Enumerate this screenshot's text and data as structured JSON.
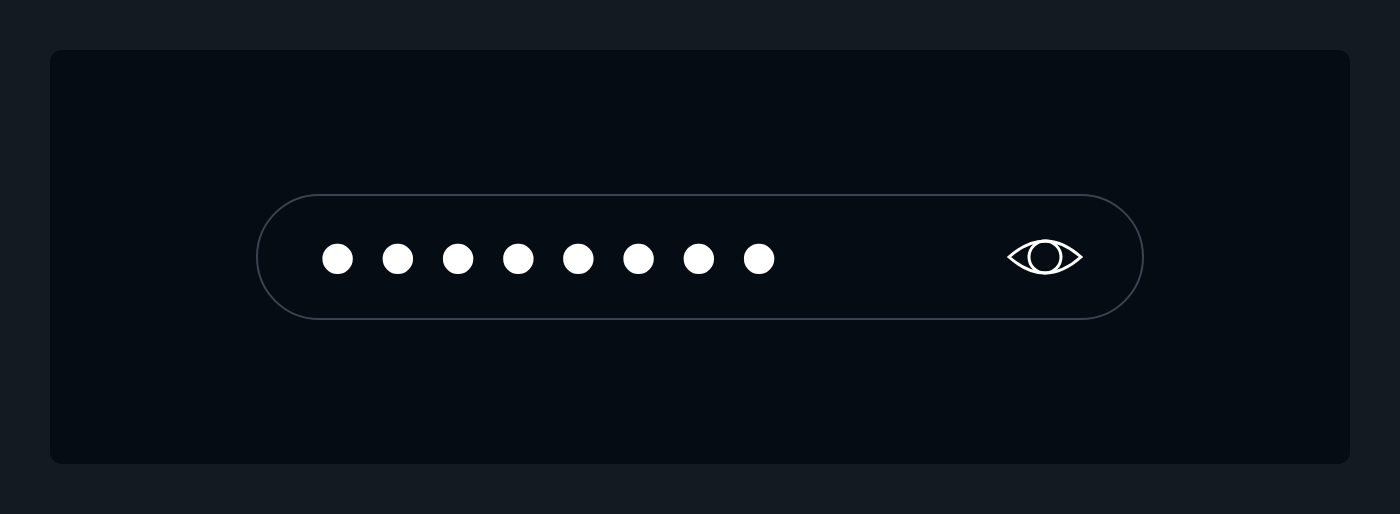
{
  "password_field": {
    "value": "••••••••"
  }
}
